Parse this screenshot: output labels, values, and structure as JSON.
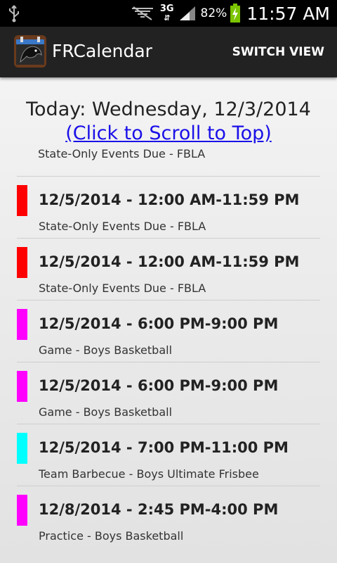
{
  "status_bar": {
    "network": "3G",
    "battery": "82%",
    "clock": "11:57 AM"
  },
  "action_bar": {
    "title": "FRCalendar",
    "switch_view_label": "SWITCH VIEW"
  },
  "header": {
    "today": "Today: Wednesday, 12/3/2014",
    "scroll_link": "(Click to Scroll to Top)"
  },
  "partial_item_text": "State-Only Events Due - FBLA",
  "events": [
    {
      "time": "12/5/2014 - 12:00 AM-11:59 PM",
      "desc": "State-Only Events Due - FBLA",
      "color": "#ff0000"
    },
    {
      "time": "12/5/2014 - 12:00 AM-11:59 PM",
      "desc": "State-Only Events Due - FBLA",
      "color": "#ff0000"
    },
    {
      "time": "12/5/2014 - 6:00 PM-9:00 PM",
      "desc": "Game - Boys Basketball",
      "color": "#ff00ff"
    },
    {
      "time": "12/5/2014 - 6:00 PM-9:00 PM",
      "desc": "Game - Boys Basketball",
      "color": "#ff00ff"
    },
    {
      "time": "12/5/2014 - 7:00 PM-11:00 PM",
      "desc": "Team Barbecue - Boys Ultimate Frisbee",
      "color": "#00ffff"
    },
    {
      "time": "12/8/2014 - 2:45 PM-4:00 PM",
      "desc": "Practice - Boys Basketball",
      "color": "#ff00ff"
    }
  ]
}
